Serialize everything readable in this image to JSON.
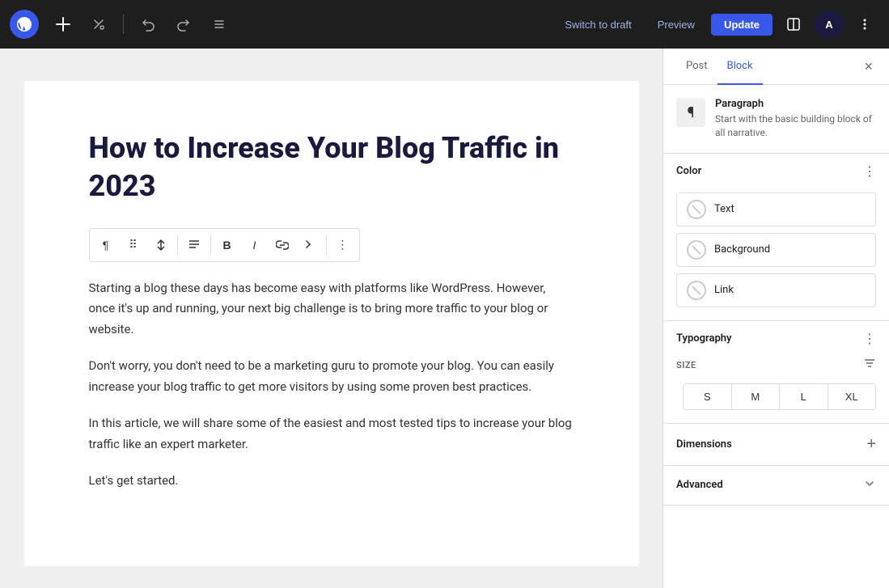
{
  "topbar": {
    "undo_label": "↩",
    "redo_label": "↪",
    "list_view_label": "≡",
    "switch_draft": "Switch to draft",
    "preview": "Preview",
    "update": "Update",
    "more_options": "⋮"
  },
  "editor": {
    "title": "How to Increase Your Blog Traffic in 2023",
    "paragraphs": [
      "Starting a blog these days has become easy with platforms like WordPress. However, once it's up and running, your next big challenge is to bring more traffic to your blog or website.",
      "Don't worry, you don't need to be a marketing guru to promote your blog. You can easily increase your blog traffic to get more visitors by using some proven best practices.",
      "In this article, we will share some of the easiest and most tested tips to increase your blog traffic like an expert marketer.",
      "Let's get started."
    ]
  },
  "block_toolbar": {
    "paragraph_icon": "¶",
    "drag_icon": "⠿",
    "align_icon": "≡",
    "bold_icon": "B",
    "italic_icon": "I",
    "link_icon": "🔗",
    "more_icon": "⋮"
  },
  "sidebar": {
    "tab_post": "Post",
    "tab_block": "Block",
    "close_icon": "×",
    "block_icon": "¶",
    "block_name": "Paragraph",
    "block_desc": "Start with the basic building block of all narrative.",
    "color_section": {
      "title": "Color",
      "more_icon": "⋮",
      "options": [
        {
          "label": "Text"
        },
        {
          "label": "Background"
        },
        {
          "label": "Link"
        }
      ]
    },
    "typography_section": {
      "title": "Typography",
      "more_icon": "⋮",
      "size_label": "SIZE",
      "sizes": [
        "S",
        "M",
        "L",
        "XL"
      ]
    },
    "dimensions_section": {
      "title": "Dimensions",
      "add_icon": "+"
    },
    "advanced_section": {
      "title": "Advanced",
      "chevron": "∨"
    }
  }
}
